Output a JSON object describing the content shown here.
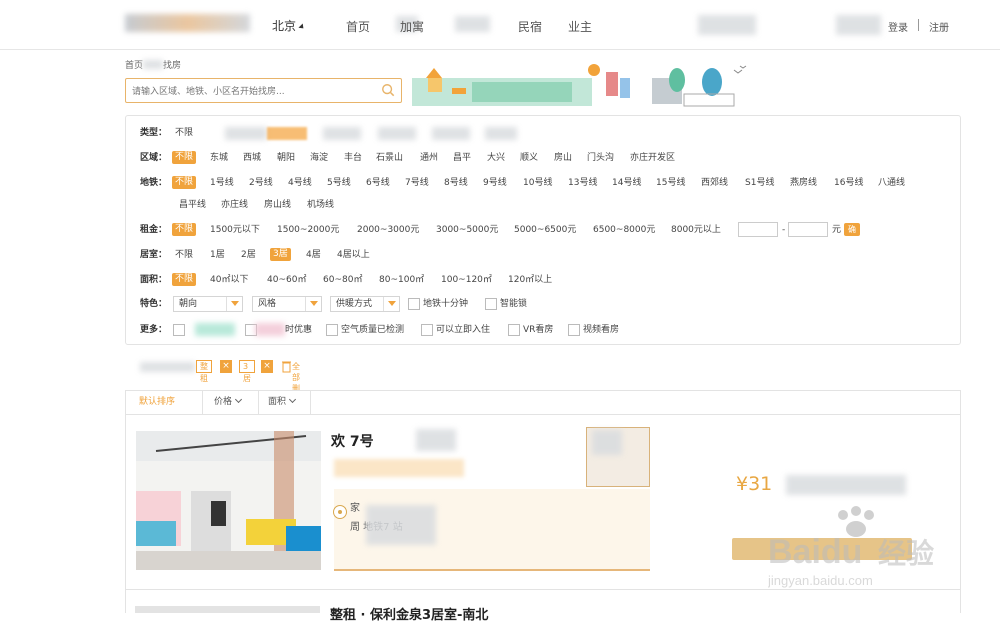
{
  "header": {
    "city": "北京",
    "nav": [
      "首页",
      "    加寓",
      "民宿",
      "业主"
    ],
    "login": "登录",
    "register": "注册"
  },
  "breadcrumb": {
    "home": "首页",
    "current": "找房"
  },
  "search": {
    "placeholder": "请输入区域、地铁、小区名开始找房..."
  },
  "filters": {
    "type": {
      "label": "类型：",
      "options": [
        "不限"
      ]
    },
    "area": {
      "label": "区域：",
      "options": [
        "不限",
        "东城",
        "西城",
        "朝阳",
        "海淀",
        "丰台",
        "石景山",
        "通州",
        "昌平",
        "大兴",
        "顺义",
        "房山",
        "门头沟",
        "亦庄开发区"
      ]
    },
    "subway": {
      "label": "地铁：",
      "options": [
        "不限",
        "1号线",
        "2号线",
        "4号线",
        "5号线",
        "6号线",
        "7号线",
        "8号线",
        "9号线",
        "10号线",
        "13号线",
        "14号线",
        "15号线",
        "西郊线",
        "S1号线",
        "燕房线",
        "16号线",
        "八通线"
      ],
      "options2": [
        "昌平线",
        "亦庄线",
        "房山线",
        "机场线"
      ]
    },
    "rent": {
      "label": "租金：",
      "options": [
        "不限",
        "1500元以下",
        "1500~2000元",
        "2000~3000元",
        "3000~5000元",
        "5000~6500元",
        "6500~8000元",
        "8000元以上"
      ],
      "dash": "-",
      "unit": "元",
      "confirm": "确定"
    },
    "rooms": {
      "label": "居室：",
      "options": [
        "不限",
        "1居",
        "2居",
        "3居",
        "4居",
        "4居以上"
      ]
    },
    "size": {
      "label": "面积：",
      "options": [
        "不限",
        "40㎡以下",
        "40~60㎡",
        "60~80㎡",
        "80~100㎡",
        "100~120㎡",
        "120㎡以上"
      ]
    },
    "feature": {
      "label": "特色：",
      "dropdowns": [
        "朝向",
        "风格",
        "供暖方式"
      ],
      "checks": [
        "地铁十分钟",
        "智能锁"
      ]
    },
    "more": {
      "label": "更多：",
      "partial": "时优惠",
      "checks": [
        "空气质量已检测",
        "可以立即入住",
        "VR看房",
        "视频看房"
      ]
    }
  },
  "chips": {
    "items": [
      "整租",
      "3居"
    ],
    "clear": "全部删除",
    "close": "×"
  },
  "sort": {
    "default": "默认排序",
    "price": "价格",
    "area": "面积"
  },
  "listing": {
    "title": "欢      7号",
    "price": "¥31",
    "addr1": "    家",
    "addr2": "周           地铁7              站"
  },
  "next": {
    "title": "整租 · 保利金泉3居室-南北"
  },
  "watermark": {
    "brand": "Baidu",
    "cn": "经验",
    "url": "jingyan.baidu.com"
  },
  "colors": {
    "accent": "#f0a33c"
  }
}
